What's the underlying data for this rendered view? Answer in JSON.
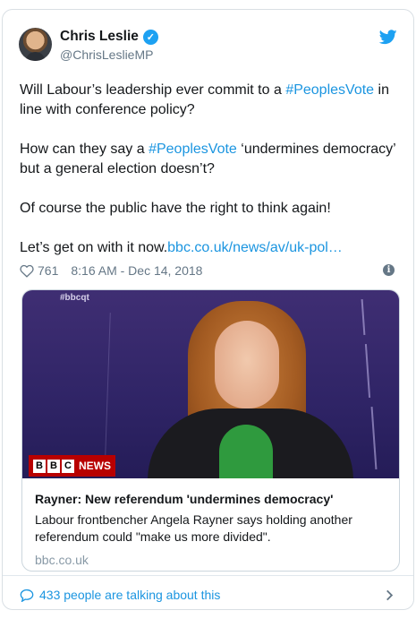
{
  "author": {
    "name": "Chris Leslie",
    "handle": "@ChrisLeslieMP",
    "verified_glyph": "✓"
  },
  "tweet": {
    "p1_pre": "Will Labour’s leadership ever commit to a ",
    "p1_tag": "#PeoplesVote",
    "p1_post": " in line with conference policy?",
    "p2_pre": "How can they say a ",
    "p2_tag": "#PeoplesVote",
    "p2_post": " ‘undermines democracy’ but a general election doesn’t?",
    "p3": "Of course the public have the right to think again!",
    "p4_pre": "Let’s get on with it now.",
    "p4_link": "bbc.co.uk/news/av/uk-pol…"
  },
  "meta": {
    "likes": "761",
    "timestamp": "8:16 AM - Dec 14, 2018",
    "info_glyph": "i"
  },
  "card": {
    "image_hashtag": "#bbcqt",
    "bbc_b1": "B",
    "bbc_b2": "B",
    "bbc_c": "C",
    "bbc_news": "NEWS",
    "title": "Rayner: New referendum 'undermines democracy'",
    "description": "Labour frontbencher Angela Rayner says holding another referendum could \"make us more divided\".",
    "domain": "bbc.co.uk"
  },
  "footer": {
    "talking": "433 people are talking about this"
  },
  "icons": {
    "twitter": "twitter-bird-icon",
    "heart": "heart-icon",
    "info": "info-icon",
    "bubble": "comment-bubble-icon",
    "chevron": "chevron-right-icon"
  },
  "colors": {
    "link": "#1b95e0",
    "muted": "#657786",
    "verified": "#1da1f2",
    "bbc_red": "#b80000"
  }
}
